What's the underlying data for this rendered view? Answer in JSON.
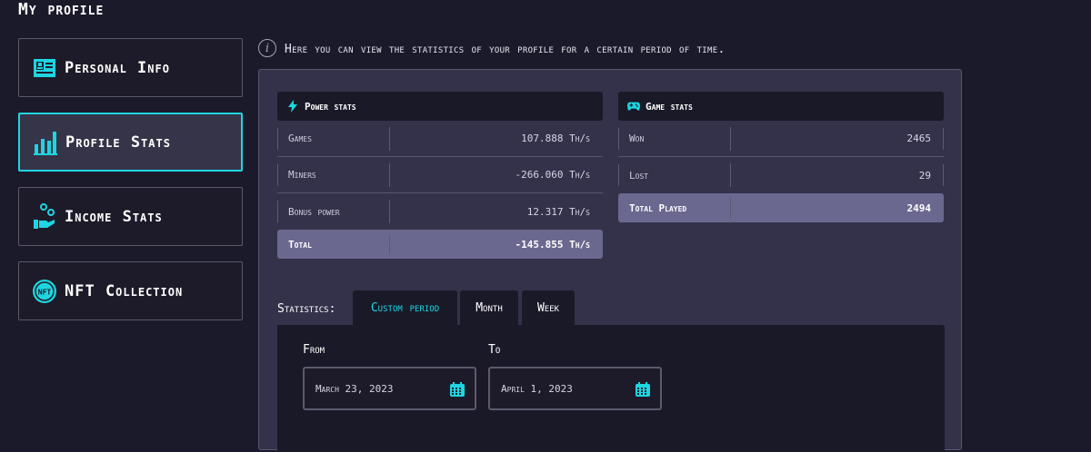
{
  "page": {
    "title": "My profile"
  },
  "sidebar": {
    "items": [
      {
        "label": "Personal Info",
        "icon": "id-card-icon",
        "active": false
      },
      {
        "label": "Profile Stats",
        "icon": "bar-chart-icon",
        "active": true
      },
      {
        "label": "Income Stats",
        "icon": "hand-coins-icon",
        "active": false
      },
      {
        "label": "NFT Collection",
        "icon": "nft-coin-icon",
        "active": false
      }
    ]
  },
  "info": {
    "icon": "info-icon",
    "text": "Here you can view the statistics of your profile for a certain period of time."
  },
  "power_stats": {
    "title": "Power stats",
    "icon": "lightning-icon",
    "rows": [
      {
        "label": "Games",
        "value": "107.888 Th/s"
      },
      {
        "label": "Miners",
        "value": "-266.060 Th/s"
      },
      {
        "label": "Bonus power",
        "value": "12.317 Th/s"
      }
    ],
    "total": {
      "label": "Total",
      "value": "-145.855 Th/s"
    }
  },
  "game_stats": {
    "title": "Game stats",
    "icon": "gamepad-icon",
    "rows": [
      {
        "label": "Won",
        "value": "2465"
      },
      {
        "label": "Lost",
        "value": "29"
      }
    ],
    "total": {
      "label": "Total Played",
      "value": "2494"
    }
  },
  "statistics": {
    "label": "Statistics:",
    "tabs": [
      {
        "label": "Custom period",
        "active": true
      },
      {
        "label": "Month",
        "active": false
      },
      {
        "label": "Week",
        "active": false
      }
    ],
    "from": {
      "label": "From",
      "value": "March 23, 2023"
    },
    "to": {
      "label": "To",
      "value": "April 1, 2023"
    }
  },
  "colors": {
    "accent": "#1ed5e1",
    "background": "#1b1a2a",
    "panel": "#33324a",
    "total_row": "#6b6890"
  }
}
